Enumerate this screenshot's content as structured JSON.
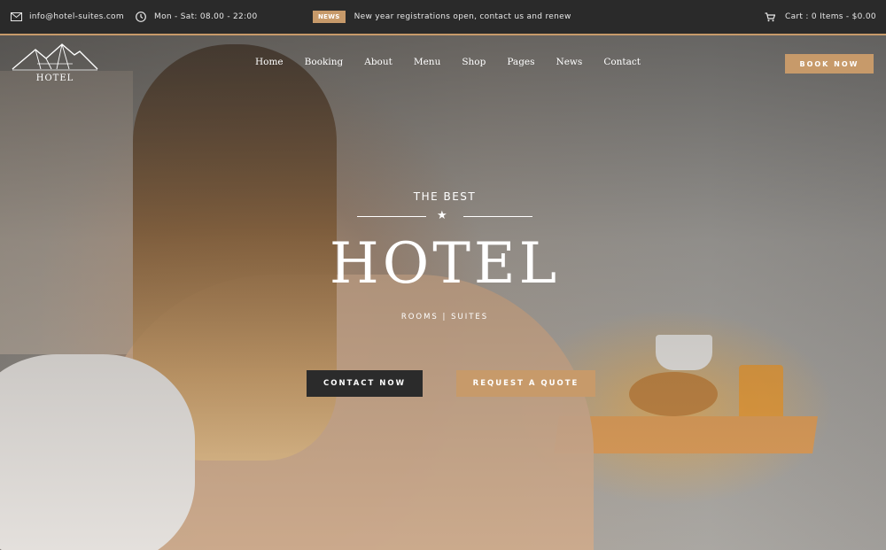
{
  "topbar": {
    "email": "info@hotel-suites.com",
    "hours": "Mon - Sat: 08.00 - 22:00",
    "news_badge": "NEWS",
    "news_text": "New year registrations open, contact us and renew yo",
    "cart": "Cart : 0 Items - $0.00"
  },
  "logo": {
    "text": "HOTEL"
  },
  "nav": {
    "items": [
      "Home",
      "Booking",
      "About",
      "Menu",
      "Shop",
      "Pages",
      "News",
      "Contact"
    ],
    "book_label": "BOOK NOW"
  },
  "hero": {
    "subtitle": "THE BEST",
    "title": "HOTEL",
    "tagline": "ROOMS | SUITES",
    "contact_label": "CONTACT NOW",
    "quote_label": "REQUEST A QUOTE"
  },
  "colors": {
    "accent": "#c79a6a",
    "dark": "#2b2b2b"
  }
}
